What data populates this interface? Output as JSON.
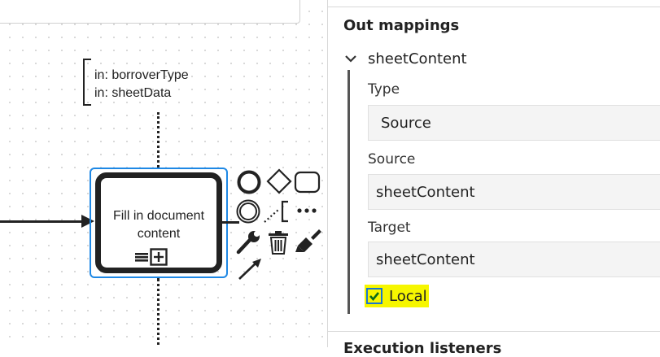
{
  "canvas": {
    "annotation_lines": [
      "in: borroverType",
      "in: sheetData"
    ],
    "task_label": "Fill in document content",
    "context_pad": {
      "icons": [
        "end-event-icon",
        "gateway-icon",
        "task-icon",
        "intermediate-event-icon",
        "text-annotation-icon",
        "more-icon",
        "wrench-icon",
        "trash-icon",
        "paint-brush-icon",
        "connect-arrow-icon"
      ]
    },
    "colors": {
      "selection": "#1e88e5",
      "stroke": "#222222"
    }
  },
  "properties": {
    "group_title": "Out mappings",
    "mapping": {
      "title": "sheetContent",
      "type_label": "Type",
      "type_value": "Source",
      "source_label": "Source",
      "source_value": "sheetContent",
      "target_label": "Target",
      "target_value": "sheetContent",
      "local_label": "Local",
      "local_checked": true
    },
    "next_group_title": "Execution listeners",
    "colors": {
      "highlight": "#f6f600",
      "checkbox": "#1976d2"
    }
  }
}
